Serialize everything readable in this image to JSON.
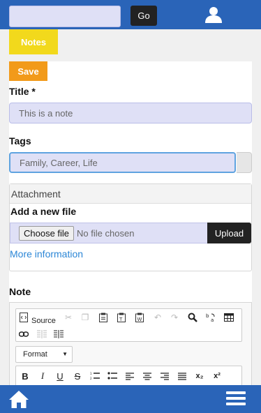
{
  "topbar": {
    "search_placeholder": "",
    "go_label": "Go"
  },
  "tabs": {
    "notes_label": "Notes"
  },
  "form": {
    "save_label": "Save",
    "title_label": "Title *",
    "title_placeholder": "This is a note",
    "tags_label": "Tags",
    "tags_placeholder": "Family, Career, Life",
    "attachment_header": "Attachment",
    "add_file_label": "Add a new file",
    "choose_file_label": "Choose file",
    "no_file_text": "No file chosen",
    "upload_label": "Upload",
    "more_info_label": "More information",
    "note_label": "Note"
  },
  "editor": {
    "source_label": "Source",
    "format_label": "Format"
  },
  "colors": {
    "header": "#2a64b8",
    "notes_tab": "#f2d91c",
    "save": "#f29a1a",
    "input_bg": "#dfe0f6",
    "link": "#2b86d6"
  }
}
